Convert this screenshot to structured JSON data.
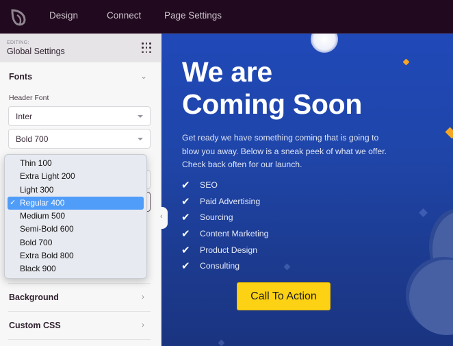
{
  "topbar": {
    "logo_icon": "leaf-logo-icon",
    "nav": [
      "Design",
      "Connect",
      "Page Settings"
    ]
  },
  "sidebar": {
    "editing_label": "EDITING:",
    "editing_title": "Global Settings",
    "menu_icon": "grid-dots-icon",
    "fonts_section": {
      "title": "Fonts",
      "header_font_label": "Header Font",
      "header_font_value": "Inter",
      "header_weight_value": "Bold 700"
    },
    "weight_dropdown": {
      "selected": "Regular 400",
      "options": [
        "Thin 100",
        "Extra Light 200",
        "Light 300",
        "Regular 400",
        "Medium 500",
        "Semi-Bold 600",
        "Bold 700",
        "Extra Bold 800",
        "Black 900"
      ]
    },
    "sections": [
      "Background",
      "Custom CSS"
    ]
  },
  "preview": {
    "headline_line1": "We are",
    "headline_line2": "Coming Soon",
    "intro": "Get ready we have something coming that is going to blow you away. Below is a sneak peek of what we offer. Check back often for our launch.",
    "features": [
      "SEO",
      "Paid Advertising",
      "Sourcing",
      "Content Marketing",
      "Product Design",
      "Consulting"
    ],
    "cta_label": "Call To Action",
    "colors": {
      "background": "#2049b8",
      "cta": "#fdd215",
      "accent_star": "#f5a623"
    }
  }
}
